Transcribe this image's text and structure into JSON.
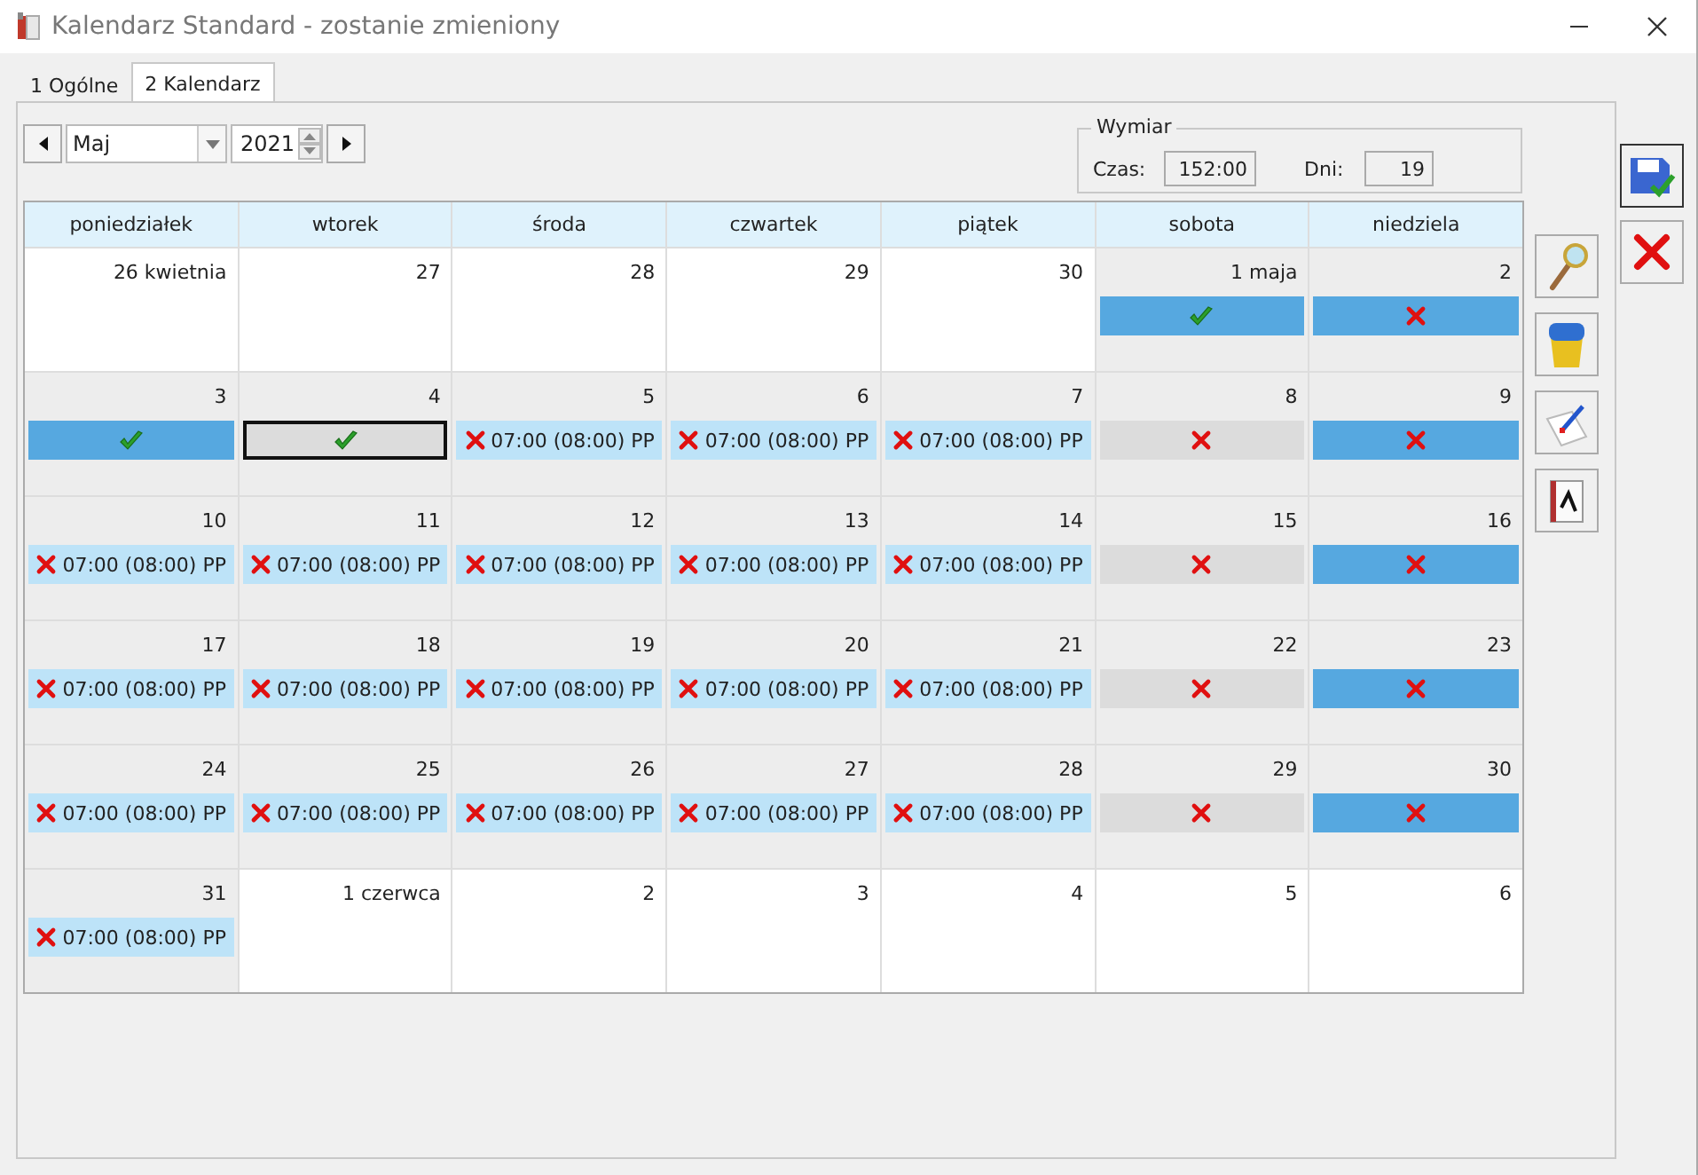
{
  "window": {
    "title": "Kalendarz Standard - zostanie zmieniony"
  },
  "tabs": [
    {
      "label": "1 Ogólne",
      "selected": false
    },
    {
      "label": "2 Kalendarz",
      "selected": true
    }
  ],
  "navigator": {
    "month": "Maj",
    "year": "2021"
  },
  "wymiar": {
    "title": "Wymiar",
    "czas_label": "Czas:",
    "czas": "152:00",
    "dni_label": "Dni:",
    "dni": "19"
  },
  "calendar": {
    "columns": [
      "poniedziałek",
      "wtorek",
      "środa",
      "czwartek",
      "piątek",
      "sobota",
      "niedziela"
    ],
    "weeks": [
      [
        {
          "day": "26 kwietnia",
          "in_month": false
        },
        {
          "day": "27",
          "in_month": false
        },
        {
          "day": "28",
          "in_month": false
        },
        {
          "day": "29",
          "in_month": false
        },
        {
          "day": "30",
          "in_month": false
        },
        {
          "day": "1 maja",
          "in_month": true,
          "entry": {
            "kind": "holiday",
            "confirmed": true,
            "selected": false
          }
        },
        {
          "day": "2",
          "in_month": true,
          "entry": {
            "kind": "holiday",
            "confirmed": false,
            "selected": false
          }
        }
      ],
      [
        {
          "day": "3",
          "in_month": true,
          "entry": {
            "kind": "holiday",
            "confirmed": true,
            "selected": false
          }
        },
        {
          "day": "4",
          "in_month": true,
          "entry": {
            "kind": "weekend",
            "confirmed": true,
            "selected": true
          }
        },
        {
          "day": "5",
          "in_month": true,
          "entry": {
            "kind": "work",
            "confirmed": false,
            "text": "07:00 (08:00) PP",
            "selected": false
          }
        },
        {
          "day": "6",
          "in_month": true,
          "entry": {
            "kind": "work",
            "confirmed": false,
            "text": "07:00 (08:00) PP",
            "selected": false
          }
        },
        {
          "day": "7",
          "in_month": true,
          "entry": {
            "kind": "work",
            "confirmed": false,
            "text": "07:00 (08:00) PP",
            "selected": false
          }
        },
        {
          "day": "8",
          "in_month": true,
          "entry": {
            "kind": "weekend",
            "confirmed": false,
            "selected": false
          }
        },
        {
          "day": "9",
          "in_month": true,
          "entry": {
            "kind": "holiday",
            "confirmed": false,
            "selected": false
          }
        }
      ],
      [
        {
          "day": "10",
          "in_month": true,
          "entry": {
            "kind": "work",
            "confirmed": false,
            "text": "07:00 (08:00) PP",
            "selected": false
          }
        },
        {
          "day": "11",
          "in_month": true,
          "entry": {
            "kind": "work",
            "confirmed": false,
            "text": "07:00 (08:00) PP",
            "selected": false
          }
        },
        {
          "day": "12",
          "in_month": true,
          "entry": {
            "kind": "work",
            "confirmed": false,
            "text": "07:00 (08:00) PP",
            "selected": false
          }
        },
        {
          "day": "13",
          "in_month": true,
          "entry": {
            "kind": "work",
            "confirmed": false,
            "text": "07:00 (08:00) PP",
            "selected": false
          }
        },
        {
          "day": "14",
          "in_month": true,
          "entry": {
            "kind": "work",
            "confirmed": false,
            "text": "07:00 (08:00) PP",
            "selected": false
          }
        },
        {
          "day": "15",
          "in_month": true,
          "entry": {
            "kind": "weekend",
            "confirmed": false,
            "selected": false
          }
        },
        {
          "day": "16",
          "in_month": true,
          "entry": {
            "kind": "holiday",
            "confirmed": false,
            "selected": false
          }
        }
      ],
      [
        {
          "day": "17",
          "in_month": true,
          "entry": {
            "kind": "work",
            "confirmed": false,
            "text": "07:00 (08:00) PP",
            "selected": false
          }
        },
        {
          "day": "18",
          "in_month": true,
          "entry": {
            "kind": "work",
            "confirmed": false,
            "text": "07:00 (08:00) PP",
            "selected": false
          }
        },
        {
          "day": "19",
          "in_month": true,
          "entry": {
            "kind": "work",
            "confirmed": false,
            "text": "07:00 (08:00) PP",
            "selected": false
          }
        },
        {
          "day": "20",
          "in_month": true,
          "entry": {
            "kind": "work",
            "confirmed": false,
            "text": "07:00 (08:00) PP",
            "selected": false
          }
        },
        {
          "day": "21",
          "in_month": true,
          "entry": {
            "kind": "work",
            "confirmed": false,
            "text": "07:00 (08:00) PP",
            "selected": false
          }
        },
        {
          "day": "22",
          "in_month": true,
          "entry": {
            "kind": "weekend",
            "confirmed": false,
            "selected": false
          }
        },
        {
          "day": "23",
          "in_month": true,
          "entry": {
            "kind": "holiday",
            "confirmed": false,
            "selected": false
          }
        }
      ],
      [
        {
          "day": "24",
          "in_month": true,
          "entry": {
            "kind": "work",
            "confirmed": false,
            "text": "07:00 (08:00) PP",
            "selected": false
          }
        },
        {
          "day": "25",
          "in_month": true,
          "entry": {
            "kind": "work",
            "confirmed": false,
            "text": "07:00 (08:00) PP",
            "selected": false
          }
        },
        {
          "day": "26",
          "in_month": true,
          "entry": {
            "kind": "work",
            "confirmed": false,
            "text": "07:00 (08:00) PP",
            "selected": false
          }
        },
        {
          "day": "27",
          "in_month": true,
          "entry": {
            "kind": "work",
            "confirmed": false,
            "text": "07:00 (08:00) PP",
            "selected": false
          }
        },
        {
          "day": "28",
          "in_month": true,
          "entry": {
            "kind": "work",
            "confirmed": false,
            "text": "07:00 (08:00) PP",
            "selected": false
          }
        },
        {
          "day": "29",
          "in_month": true,
          "entry": {
            "kind": "weekend",
            "confirmed": false,
            "selected": false
          }
        },
        {
          "day": "30",
          "in_month": true,
          "entry": {
            "kind": "holiday",
            "confirmed": false,
            "selected": false
          }
        }
      ],
      [
        {
          "day": "31",
          "in_month": true,
          "entry": {
            "kind": "work",
            "confirmed": false,
            "text": "07:00 (08:00) PP",
            "selected": false
          }
        },
        {
          "day": "1 czerwca",
          "in_month": false
        },
        {
          "day": "2",
          "in_month": false
        },
        {
          "day": "3",
          "in_month": false
        },
        {
          "day": "4",
          "in_month": false
        },
        {
          "day": "5",
          "in_month": false
        },
        {
          "day": "6",
          "in_month": false
        }
      ]
    ]
  }
}
